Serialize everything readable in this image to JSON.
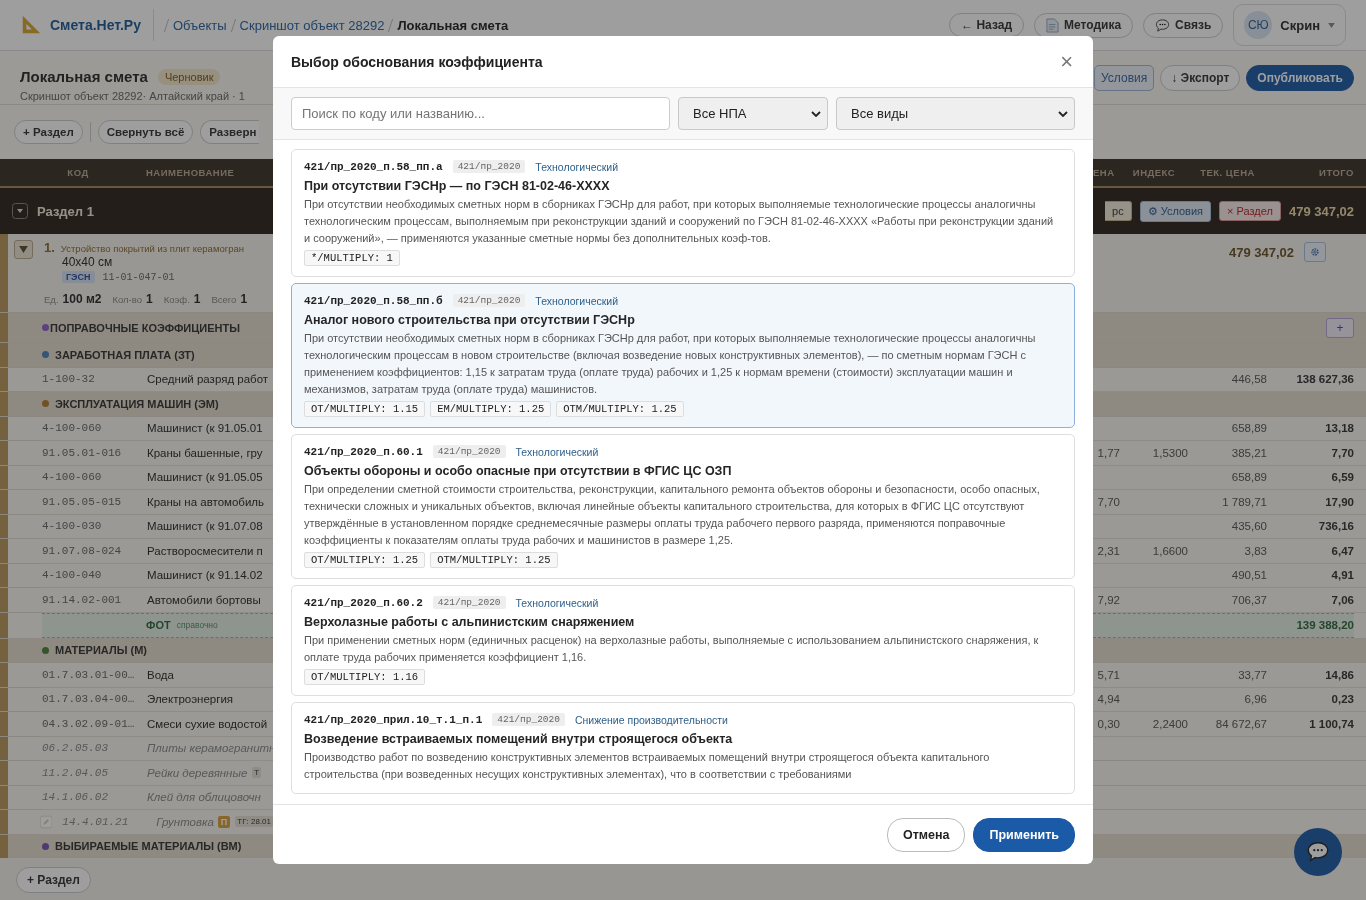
{
  "topbar": {
    "logo": "Смета.Нет.Ру",
    "breadcrumbs": [
      {
        "label": "Объекты",
        "current": false
      },
      {
        "label": "Скриншот объект 28292",
        "current": false
      },
      {
        "label": "Локальная смета",
        "current": true
      }
    ],
    "buttons": [
      {
        "label": "← Назад",
        "kind": "plain"
      },
      {
        "label": "Методика",
        "kind": "doc"
      },
      {
        "label": "Связь",
        "kind": "chat"
      }
    ],
    "user": {
      "initials": "СЮ",
      "name": "Скрин"
    }
  },
  "header": {
    "title": "Локальная смета",
    "badge": "Черновик",
    "subtitle": "Скриншот объект 28292· Алтайский край · 1",
    "left_buttons": [
      "+ Раздел",
      "Свернуть всё",
      "Разверн"
    ],
    "right_buttons": [
      {
        "label": "Условия",
        "kind": "outline"
      },
      {
        "label": "↓ Экспорт",
        "kind": "plain"
      },
      {
        "label": "Опубликовать",
        "kind": "primary"
      }
    ]
  },
  "table": {
    "columns_left": [
      "КОД",
      "НАИМЕНОВАНИЕ"
    ],
    "columns_right": [
      "ЕНА",
      "ИНДЕКС",
      "ТЕК. ЦЕНА",
      "ИТОГО"
    ],
    "section": {
      "title": "Раздел 1",
      "buttons": [
        {
          "label": "рс",
          "kind": "plain"
        },
        {
          "label": "⚙ Условия",
          "kind": "blue"
        },
        {
          "label": "× Раздел",
          "kind": "red"
        }
      ],
      "total": "479 347,02"
    },
    "item": {
      "number": "1.",
      "title": "Устройство покрытий из плит керамогран",
      "size": "40x40 см",
      "tag": "ГЭСН",
      "code": "11-01-047-01",
      "params": [
        {
          "label": "Ед.",
          "value": "100 м2"
        },
        {
          "label": "Кол-во",
          "value": "1"
        },
        {
          "label": "Коэф.",
          "value": "1"
        },
        {
          "label": "Всего",
          "value": "1"
        }
      ],
      "total": "479 347,02"
    },
    "rows": [
      {
        "kind": "coef",
        "label": "ПОПРАВОЧНЫЕ КОЭФФИЦИЕНТЫ",
        "color": "#5d407e",
        "add": "+"
      },
      {
        "kind": "group",
        "label": "ЗАРАБОТНАЯ ПЛАТА (ЗТ)",
        "color": "#355575"
      },
      {
        "kind": "line",
        "code": "1-100-32",
        "name": "Средний разряд работ",
        "price": "446,58",
        "total": "138 627,36"
      },
      {
        "kind": "group",
        "label": "ЭКСПЛУАТАЦИЯ МАШИН (ЭМ)",
        "color": "#715129"
      },
      {
        "kind": "line",
        "code": "4-100-060",
        "name": "Машинист (к 91.05.01",
        "price": "658,89",
        "total": "13,18"
      },
      {
        "kind": "line",
        "code": "91.05.01-016",
        "name": "Краны башенные, гру",
        "base": "1,77",
        "index": "1,5300",
        "price": "385,21",
        "total": "7,70"
      },
      {
        "kind": "line",
        "code": "4-100-060",
        "name": "Машинист (к 91.05.05",
        "price": "658,89",
        "total": "6,59"
      },
      {
        "kind": "line",
        "code": "91.05.05-015",
        "name": "Краны на автомобиль",
        "base": "7,70",
        "price": "1 789,71",
        "total": "17,90"
      },
      {
        "kind": "line",
        "code": "4-100-030",
        "name": "Машинист (к 91.07.08",
        "price": "435,60",
        "total": "736,16"
      },
      {
        "kind": "line",
        "code": "91.07.08-024",
        "name": "Растворосмесители п",
        "base": "2,31",
        "index": "1,6600",
        "price": "3,83",
        "total": "6,47"
      },
      {
        "kind": "line",
        "code": "4-100-040",
        "name": "Машинист (к 91.14.02",
        "price": "490,51",
        "total": "4,91"
      },
      {
        "kind": "line",
        "code": "91.14.02-001",
        "name": "Автомобили бортовы",
        "base": "7,92",
        "price": "706,37",
        "total": "7,06"
      },
      {
        "kind": "fot",
        "label": "ФОТ",
        "note": "справочно",
        "total": "139 388,20"
      },
      {
        "kind": "group",
        "label": "МАТЕРИАЛЫ (М)",
        "color": "#38532c"
      },
      {
        "kind": "line",
        "code": "01.7.03.01-00…",
        "name": "Вода",
        "base": "5,71",
        "price": "33,77",
        "total": "14,86"
      },
      {
        "kind": "line",
        "code": "01.7.03.04-00…",
        "name": "Электроэнергия",
        "base": "4,94",
        "price": "6,96",
        "total": "0,23"
      },
      {
        "kind": "line",
        "code": "04.3.02.09-01…",
        "name": "Смеси сухие водостой",
        "base": "0,30",
        "index": "2,2400",
        "price": "84 672,67",
        "total": "1 100,74"
      },
      {
        "kind": "muted",
        "code": "06.2.05.03",
        "name": "Плиты керамогранитн"
      },
      {
        "kind": "muted",
        "code": "11.2.04.05",
        "name": "Рейки деревянные",
        "tag": "Т"
      },
      {
        "kind": "muted",
        "code": "14.1.06.02",
        "name": "Клей для облицовочн"
      },
      {
        "kind": "custom",
        "code": "14.4.01.21",
        "name": "Грунтовка",
        "badge": "П",
        "tag": "ТГ: 28.01"
      },
      {
        "kind": "group",
        "label": "ВЫБИРАЕМЫЕ МАТЕРИАЛЫ (ВМ)",
        "color": "#513871"
      }
    ]
  },
  "footer_button": "+ Раздел",
  "modal": {
    "title": "Выбор обоснования коэффициента",
    "close": "×",
    "search": {
      "placeholder": "Поиск по коду или названию..."
    },
    "filters": [
      "Все НПА",
      "Все виды"
    ],
    "cards": [
      {
        "code": "421/пр_2020_п.58_пп.а",
        "npa": "421/пр_2020",
        "type": "Технологический",
        "selected": false,
        "title": "При отсутствии ГЭСНр — по ГЭСН 81-02-46-XXXX",
        "text": "При отсутствии необходимых сметных норм в сборниках ГЭСНр для работ, при которых выполняемые технологические процессы аналогичны технологическим процессам, выполняемым при реконструкции зданий и сооружений по ГЭСН 81-02-46-XXXX «Работы при реконструкции зданий и сооружений», — применяются указанные сметные нормы без дополнительных коэф-тов.",
        "chips": [
          "*/MULTIPLY: 1"
        ]
      },
      {
        "code": "421/пр_2020_п.58_пп.б",
        "npa": "421/пр_2020",
        "type": "Технологический",
        "selected": true,
        "title": "Аналог нового строительства при отсутствии ГЭСНр",
        "text": "При отсутствии необходимых сметных норм в сборниках ГЭСНр для работ, при которых выполняемые технологические процессы аналогичны технологическим процессам в новом строительстве (включая возведение новых конструктивных элементов), — по сметным нормам ГЭСН с применением коэффициентов: 1,15 к затратам труда (оплате труда) рабочих и 1,25 к нормам времени (стоимости) эксплуатации машин и механизмов, затратам труда (оплате труда) машинистов.",
        "chips": [
          "OT/MULTIPLY: 1.15",
          "EM/MULTIPLY: 1.25",
          "OTM/MULTIPLY: 1.25"
        ]
      },
      {
        "code": "421/пр_2020_п.60.1",
        "npa": "421/пр_2020",
        "type": "Технологический",
        "selected": false,
        "title": "Объекты обороны и особо опасные при отсутствии в ФГИС ЦС ОЗП",
        "text": "При определении сметной стоимости строительства, реконструкции, капитального ремонта объектов обороны и безопасности, особо опасных, технически сложных и уникальных объектов, включая линейные объекты капитального строительства, для которых в ФГИС ЦС отсутствуют утверждённые в установленном порядке среднемесячные размеры оплаты труда рабочего первого разряда, применяются поправочные коэффициенты к показателям оплаты труда рабочих и машинистов в размере 1,25.",
        "chips": [
          "OT/MULTIPLY: 1.25",
          "OTM/MULTIPLY: 1.25"
        ]
      },
      {
        "code": "421/пр_2020_п.60.2",
        "npa": "421/пр_2020",
        "type": "Технологический",
        "selected": false,
        "title": "Верхолазные работы с альпинистским снаряжением",
        "text": "При применении сметных норм (единичных расценок) на верхолазные работы, выполняемые с использованием альпинистского снаряжения, к оплате труда рабочих применяется коэффициент 1,16.",
        "chips": [
          "OT/MULTIPLY: 1.16"
        ]
      },
      {
        "code": "421/пр_2020_прил.10_т.1_п.1",
        "npa": "421/пр_2020",
        "type": "Снижение производительности",
        "selected": false,
        "title": "Возведение встраиваемых помещений внутри строящегося объекта",
        "text": "Производство работ по возведению конструктивных элементов встраиваемых помещений внутри строящегося объекта капитального строительства (при возведенных несущих конструктивных элементах), что в соответствии с требованиями"
      }
    ],
    "buttons": [
      {
        "label": "Отмена",
        "kind": "secondary"
      },
      {
        "label": "Применить",
        "kind": "primary"
      }
    ]
  }
}
